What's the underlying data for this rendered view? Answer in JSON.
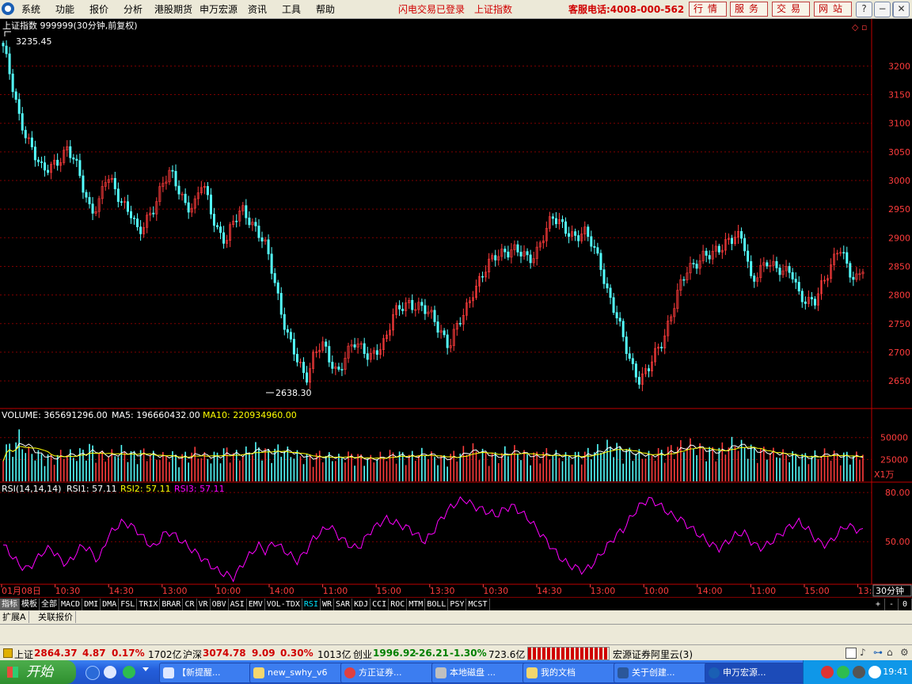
{
  "menu": [
    "系统",
    "功能",
    "报价",
    "分析",
    "港股期货",
    "申万宏源",
    "资讯",
    "工具",
    "帮助"
  ],
  "header_status": [
    "闪电交易已登录",
    "上证指数"
  ],
  "hotline": "客服电话:4008-000-562",
  "header_buttons": [
    "行情",
    "服务",
    "交易",
    "网站"
  ],
  "window_buttons": [
    "?",
    "−",
    "❐",
    "✕"
  ],
  "chart": {
    "title": "上证指数 999999(30分钟,前复权)",
    "high_label": "3235.45",
    "low_label": "2638.30",
    "volume_label": "VOLUME: 365691296.00",
    "ma5_label": "MA5: 196660432.00",
    "ma10_label": "MA10: 220934960.00",
    "rsi_label": "RSI(14,14,14)",
    "rsi1_label": "RSI1: 57.11",
    "rsi2_label": "RSI2: 57.11",
    "rsi3_label": "RSI3: 57.11",
    "unit": "X1万",
    "period": "30分钟",
    "time_labels": [
      "01月08日",
      "10:30",
      "14:30",
      "13:00",
      "10:00",
      "14:00",
      "11:00",
      "15:00",
      "13:30",
      "10:30",
      "14:30",
      "13:00",
      "10:00",
      "14:00",
      "11:00",
      "15:00",
      "13:3"
    ],
    "colors": {
      "up": "#ff3c3c",
      "down": "#54ffff",
      "ma5": "#ffffff",
      "ma10": "#ffff00",
      "rsi": "#ff00ff",
      "grid": "#800000",
      "axis": "#ff3c3c"
    }
  },
  "chart_data": {
    "type": "candlestick",
    "y_ticks": [
      2650,
      2700,
      2750,
      2800,
      2850,
      2900,
      2950,
      3000,
      3050,
      3100,
      3150,
      3200
    ],
    "ylim": [
      2610,
      3260
    ],
    "volume_ticks": [
      25000,
      50000
    ],
    "volume_ylim": [
      0,
      66000
    ],
    "rsi_ticks": [
      50.0,
      80.0
    ],
    "rsi_ylim": [
      25,
      82
    ],
    "close": [
      3235,
      3170,
      3110,
      3080,
      3045,
      3010,
      3025,
      3040,
      3055,
      3030,
      2990,
      2950,
      2960,
      3005,
      2985,
      2965,
      2945,
      2900,
      2930,
      2960,
      2995,
      3010,
      2985,
      2960,
      2955,
      2995,
      2950,
      2915,
      2895,
      2925,
      2950,
      2935,
      2910,
      2880,
      2830,
      2770,
      2720,
      2680,
      2650,
      2700,
      2720,
      2680,
      2660,
      2700,
      2720,
      2700,
      2690,
      2710,
      2720,
      2760,
      2780,
      2790,
      2780,
      2770,
      2760,
      2740,
      2710,
      2740,
      2770,
      2810,
      2830,
      2850,
      2870,
      2880,
      2880,
      2870,
      2860,
      2880,
      2910,
      2930,
      2925,
      2915,
      2900,
      2905,
      2890,
      2860,
      2800,
      2760,
      2720,
      2680,
      2650,
      2665,
      2700,
      2730,
      2770,
      2810,
      2845,
      2860,
      2870,
      2865,
      2880,
      2900,
      2905,
      2890,
      2820,
      2850,
      2860,
      2840,
      2840,
      2850,
      2800,
      2780,
      2790,
      2830,
      2850,
      2880,
      2850,
      2830,
      2850
    ],
    "volume": [
      42000,
      38000,
      52000,
      35000,
      33000,
      30000,
      28000,
      31000,
      34000,
      29000,
      36000,
      40000,
      32000,
      30000,
      33000,
      37000,
      31000,
      35000,
      33000,
      30000,
      29000,
      32000,
      28000,
      31000,
      35000,
      30000,
      27000,
      33000,
      36000,
      32000,
      31000,
      38000,
      40000,
      34000,
      36000,
      39000,
      33000,
      31000,
      28000,
      30000,
      32000,
      29000,
      27000,
      30000,
      31000,
      28000,
      26000,
      29000,
      30000,
      33000,
      31000,
      30000,
      32000,
      34000,
      29000,
      27000,
      30000,
      32000,
      36000,
      38000,
      34000,
      31000,
      30000,
      35000,
      37000,
      33000,
      30000,
      31000,
      34000,
      32000,
      30000,
      29000,
      31000,
      33000,
      35000,
      38000,
      42000,
      40000,
      36000,
      34000,
      32000,
      30000,
      33000,
      36000,
      38000,
      41000,
      44000,
      40000,
      37000,
      36000,
      38000,
      42000,
      46000,
      40000,
      38000,
      36000,
      35000,
      33000,
      32000,
      31000,
      30000,
      29000,
      31000,
      33000,
      32000,
      30000,
      31000,
      29000,
      34000
    ],
    "rsi": [
      48,
      42,
      36,
      33,
      38,
      44,
      46,
      40,
      36,
      42,
      48,
      44,
      38,
      52,
      58,
      62,
      60,
      56,
      50,
      46,
      54,
      56,
      52,
      48,
      44,
      40,
      36,
      32,
      30,
      28,
      36,
      42,
      48,
      44,
      50,
      46,
      42,
      38,
      44,
      52,
      56,
      60,
      54,
      50,
      46,
      48,
      56,
      60,
      64,
      62,
      60,
      58,
      54,
      50,
      56,
      64,
      70,
      74,
      76,
      72,
      70,
      68,
      66,
      70,
      72,
      68,
      64,
      58,
      52,
      46,
      40,
      36,
      34,
      32,
      36,
      42,
      48,
      54,
      58,
      66,
      72,
      76,
      74,
      70,
      66,
      64,
      60,
      56,
      52,
      48,
      46,
      50,
      54,
      56,
      50,
      46,
      48,
      52,
      56,
      60,
      62,
      58,
      52,
      48,
      50,
      56,
      60,
      58,
      56
    ]
  },
  "indicator_tabs": [
    "指标",
    "模板",
    "全部",
    "MACD",
    "DMI",
    "DMA",
    "FSL",
    "TRIX",
    "BRAR",
    "CR",
    "VR",
    "OBV",
    "ASI",
    "EMV",
    "VOL-TDX",
    "RSI",
    "WR",
    "SAR",
    "KDJ",
    "CCI",
    "ROC",
    "MTM",
    "BOLL",
    "PSY",
    "MCST"
  ],
  "active_tab": "RSI",
  "side_controls": [
    "+",
    "-",
    "0"
  ],
  "ext_tabs": [
    "扩展A",
    "关联报价"
  ],
  "status": {
    "sh_name": "上证",
    "sh_value": "2864.37",
    "sh_change": "4.87",
    "sh_pct": "0.17%",
    "sh_vol": "1702亿",
    "sz_name": "沪深",
    "sz_value": "3074.78",
    "sz_change": "9.09",
    "sz_pct": "0.30%",
    "sz_vol": "1013亿",
    "cy_name": "创业",
    "cy_value": "1996.92",
    "cy_change": "-26.21",
    "cy_pct": "-1.30%",
    "cy_vol": "723.6亿",
    "broker": "宏源证券阿里云(3)"
  },
  "taskbar": {
    "start": "开始",
    "tasks": [
      "【新提醒...",
      "new_swhy_v6",
      "方正证券...",
      "本地磁盘 ...",
      "我的文档",
      "关于创建...",
      "申万宏源..."
    ],
    "clock": "19:41"
  }
}
